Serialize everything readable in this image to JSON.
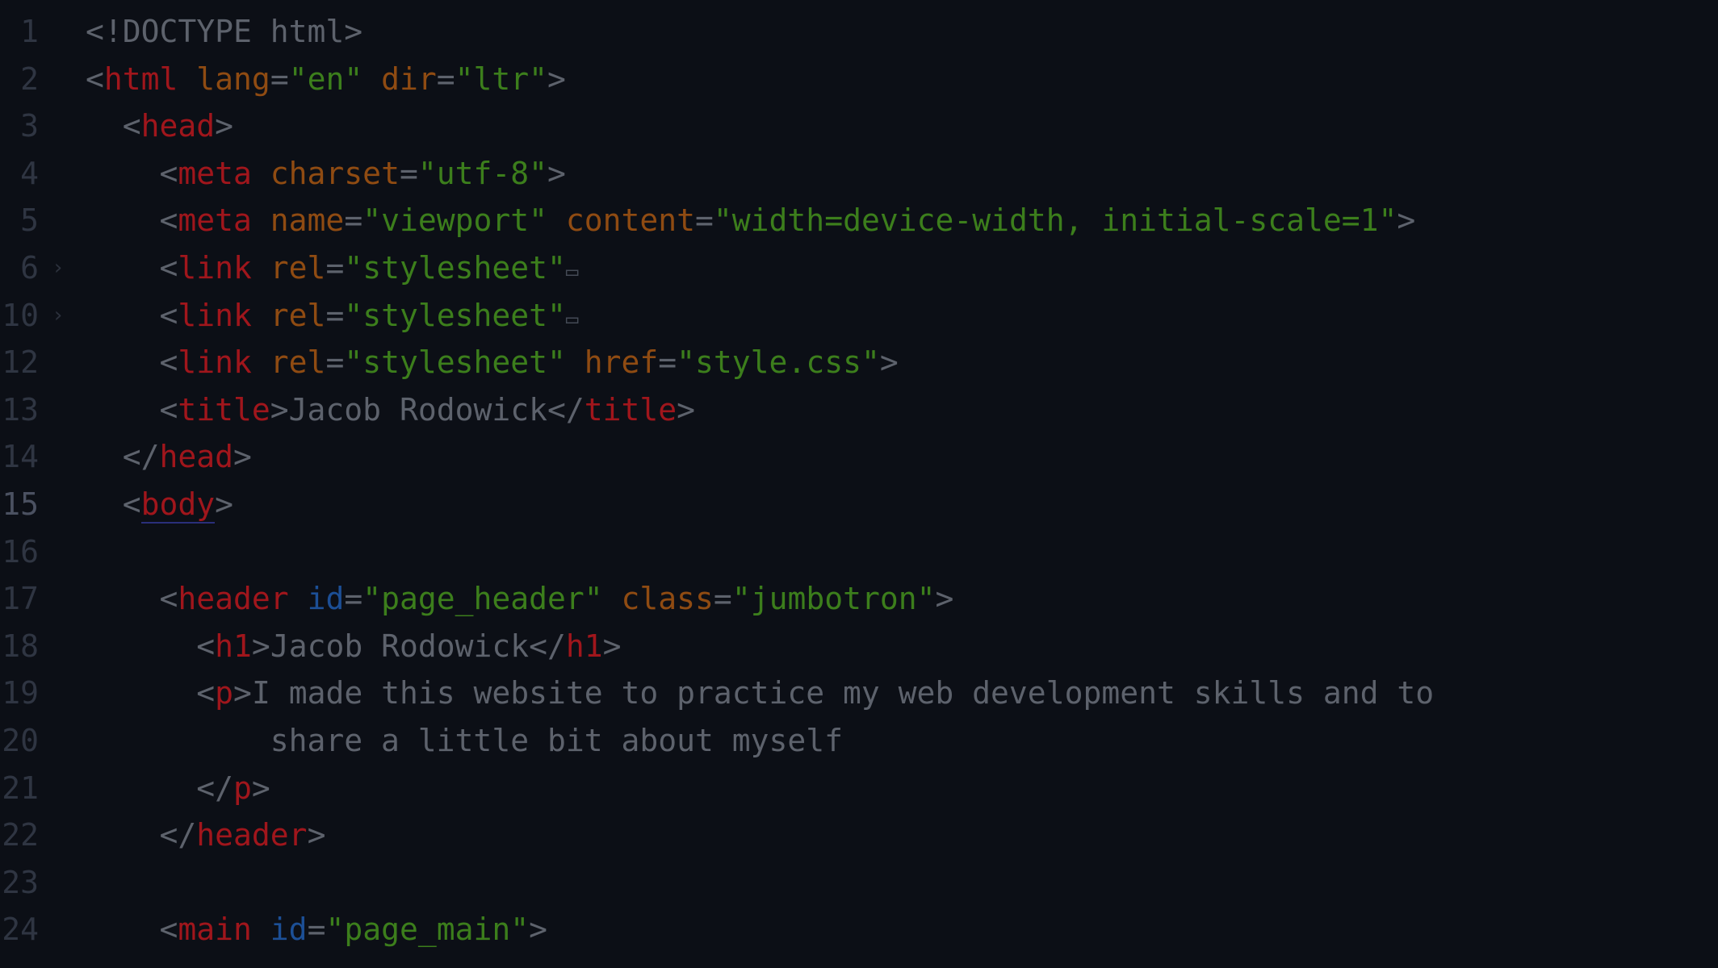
{
  "editor": {
    "lines": [
      {
        "num": "1",
        "tokens": [
          {
            "t": "<!DOCTYPE html>",
            "c": "d"
          }
        ]
      },
      {
        "num": "2",
        "tokens": [
          {
            "t": "<",
            "c": "p"
          },
          {
            "t": "html",
            "c": "t"
          },
          {
            "t": " ",
            "c": "x"
          },
          {
            "t": "lang",
            "c": "a"
          },
          {
            "t": "=",
            "c": "p"
          },
          {
            "t": "\"en\"",
            "c": "s"
          },
          {
            "t": " ",
            "c": "x"
          },
          {
            "t": "dir",
            "c": "a"
          },
          {
            "t": "=",
            "c": "p"
          },
          {
            "t": "\"ltr\"",
            "c": "s"
          },
          {
            "t": ">",
            "c": "p"
          }
        ]
      },
      {
        "num": "3",
        "tokens": [
          {
            "t": "  <",
            "c": "p"
          },
          {
            "t": "head",
            "c": "t"
          },
          {
            "t": ">",
            "c": "p"
          }
        ]
      },
      {
        "num": "4",
        "tokens": [
          {
            "t": "    <",
            "c": "p"
          },
          {
            "t": "meta",
            "c": "t"
          },
          {
            "t": " ",
            "c": "x"
          },
          {
            "t": "charset",
            "c": "a"
          },
          {
            "t": "=",
            "c": "p"
          },
          {
            "t": "\"utf-8\"",
            "c": "s"
          },
          {
            "t": ">",
            "c": "p"
          }
        ]
      },
      {
        "num": "5",
        "tokens": [
          {
            "t": "    <",
            "c": "p"
          },
          {
            "t": "meta",
            "c": "t"
          },
          {
            "t": " ",
            "c": "x"
          },
          {
            "t": "name",
            "c": "a"
          },
          {
            "t": "=",
            "c": "p"
          },
          {
            "t": "\"viewport\"",
            "c": "s"
          },
          {
            "t": " ",
            "c": "x"
          },
          {
            "t": "content",
            "c": "a"
          },
          {
            "t": "=",
            "c": "p"
          },
          {
            "t": "\"width=device-width, initial-scale=1\"",
            "c": "s"
          },
          {
            "t": ">",
            "c": "p"
          }
        ]
      },
      {
        "num": "6",
        "fold": "›",
        "tokens": [
          {
            "t": "    <",
            "c": "p"
          },
          {
            "t": "link",
            "c": "t"
          },
          {
            "t": " ",
            "c": "x"
          },
          {
            "t": "rel",
            "c": "a"
          },
          {
            "t": "=",
            "c": "p"
          },
          {
            "t": "\"stylesheet\"",
            "c": "s"
          },
          {
            "t": "▭",
            "c": "f"
          }
        ]
      },
      {
        "num": "10",
        "fold": "›",
        "tokens": [
          {
            "t": "    <",
            "c": "p"
          },
          {
            "t": "link",
            "c": "t"
          },
          {
            "t": " ",
            "c": "x"
          },
          {
            "t": "rel",
            "c": "a"
          },
          {
            "t": "=",
            "c": "p"
          },
          {
            "t": "\"stylesheet\"",
            "c": "s"
          },
          {
            "t": "▭",
            "c": "f"
          }
        ]
      },
      {
        "num": "12",
        "tokens": [
          {
            "t": "    <",
            "c": "p"
          },
          {
            "t": "link",
            "c": "t"
          },
          {
            "t": " ",
            "c": "x"
          },
          {
            "t": "rel",
            "c": "a"
          },
          {
            "t": "=",
            "c": "p"
          },
          {
            "t": "\"stylesheet\"",
            "c": "s"
          },
          {
            "t": " ",
            "c": "x"
          },
          {
            "t": "href",
            "c": "a"
          },
          {
            "t": "=",
            "c": "p"
          },
          {
            "t": "\"style.css\"",
            "c": "s"
          },
          {
            "t": ">",
            "c": "p"
          }
        ]
      },
      {
        "num": "13",
        "tokens": [
          {
            "t": "    <",
            "c": "p"
          },
          {
            "t": "title",
            "c": "t"
          },
          {
            "t": ">",
            "c": "p"
          },
          {
            "t": "Jacob Rodowick",
            "c": "x"
          },
          {
            "t": "</",
            "c": "p"
          },
          {
            "t": "title",
            "c": "t"
          },
          {
            "t": ">",
            "c": "p"
          }
        ]
      },
      {
        "num": "14",
        "tokens": [
          {
            "t": "  </",
            "c": "p"
          },
          {
            "t": "head",
            "c": "t"
          },
          {
            "t": ">",
            "c": "p"
          }
        ]
      },
      {
        "num": "15",
        "active": true,
        "tokens": [
          {
            "t": "  <",
            "c": "p"
          },
          {
            "t": "body",
            "c": "u"
          },
          {
            "t": ">",
            "c": "p"
          }
        ]
      },
      {
        "num": "16",
        "tokens": []
      },
      {
        "num": "17",
        "tokens": [
          {
            "t": "    <",
            "c": "p"
          },
          {
            "t": "header",
            "c": "t"
          },
          {
            "t": " ",
            "c": "x"
          },
          {
            "t": "id",
            "c": "i"
          },
          {
            "t": "=",
            "c": "p"
          },
          {
            "t": "\"page_header\"",
            "c": "s"
          },
          {
            "t": " ",
            "c": "x"
          },
          {
            "t": "class",
            "c": "a"
          },
          {
            "t": "=",
            "c": "p"
          },
          {
            "t": "\"jumbotron\"",
            "c": "s"
          },
          {
            "t": ">",
            "c": "p"
          }
        ]
      },
      {
        "num": "18",
        "tokens": [
          {
            "t": "      <",
            "c": "p"
          },
          {
            "t": "h1",
            "c": "t"
          },
          {
            "t": ">",
            "c": "p"
          },
          {
            "t": "Jacob Rodowick",
            "c": "x"
          },
          {
            "t": "</",
            "c": "p"
          },
          {
            "t": "h1",
            "c": "t"
          },
          {
            "t": ">",
            "c": "p"
          }
        ]
      },
      {
        "num": "19",
        "tokens": [
          {
            "t": "      <",
            "c": "p"
          },
          {
            "t": "p",
            "c": "t"
          },
          {
            "t": ">",
            "c": "p"
          },
          {
            "t": "I made this website to practice my web development skills and to",
            "c": "x"
          }
        ]
      },
      {
        "num": "20",
        "tokens": [
          {
            "t": "          share a little bit about myself",
            "c": "x"
          }
        ]
      },
      {
        "num": "21",
        "tokens": [
          {
            "t": "      </",
            "c": "p"
          },
          {
            "t": "p",
            "c": "t"
          },
          {
            "t": ">",
            "c": "p"
          }
        ]
      },
      {
        "num": "22",
        "tokens": [
          {
            "t": "    </",
            "c": "p"
          },
          {
            "t": "header",
            "c": "t"
          },
          {
            "t": ">",
            "c": "p"
          }
        ]
      },
      {
        "num": "23",
        "tokens": []
      },
      {
        "num": "24",
        "tokens": [
          {
            "t": "    <",
            "c": "p"
          },
          {
            "t": "main",
            "c": "t"
          },
          {
            "t": " ",
            "c": "x"
          },
          {
            "t": "id",
            "c": "i"
          },
          {
            "t": "=",
            "c": "p"
          },
          {
            "t": "\"page_main\"",
            "c": "s"
          },
          {
            "t": ">",
            "c": "p"
          }
        ]
      }
    ]
  }
}
